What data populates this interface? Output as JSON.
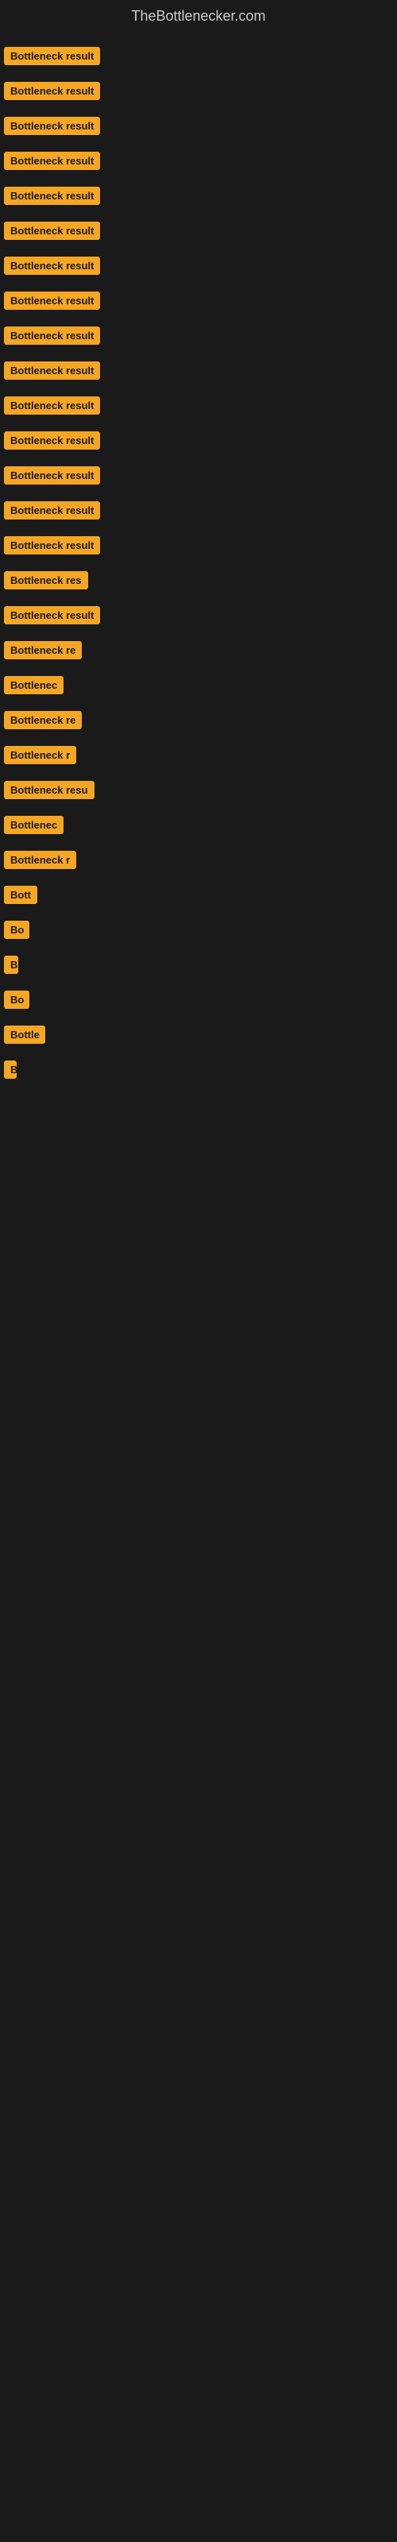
{
  "site": {
    "title": "TheBottlenecker.com"
  },
  "items": [
    {
      "label": "Bottleneck result",
      "width": 155
    },
    {
      "label": "Bottleneck result",
      "width": 155
    },
    {
      "label": "Bottleneck result",
      "width": 155
    },
    {
      "label": "Bottleneck result",
      "width": 155
    },
    {
      "label": "Bottleneck result",
      "width": 155
    },
    {
      "label": "Bottleneck result",
      "width": 155
    },
    {
      "label": "Bottleneck result",
      "width": 155
    },
    {
      "label": "Bottleneck result",
      "width": 155
    },
    {
      "label": "Bottleneck result",
      "width": 155
    },
    {
      "label": "Bottleneck result",
      "width": 155
    },
    {
      "label": "Bottleneck result",
      "width": 155
    },
    {
      "label": "Bottleneck result",
      "width": 155
    },
    {
      "label": "Bottleneck result",
      "width": 155
    },
    {
      "label": "Bottleneck result",
      "width": 155
    },
    {
      "label": "Bottleneck result",
      "width": 155
    },
    {
      "label": "Bottleneck res",
      "width": 120
    },
    {
      "label": "Bottleneck result",
      "width": 155
    },
    {
      "label": "Bottleneck re",
      "width": 110
    },
    {
      "label": "Bottlenec",
      "width": 85
    },
    {
      "label": "Bottleneck re",
      "width": 110
    },
    {
      "label": "Bottleneck r",
      "width": 100
    },
    {
      "label": "Bottleneck resu",
      "width": 125
    },
    {
      "label": "Bottlenec",
      "width": 80
    },
    {
      "label": "Bottleneck r",
      "width": 95
    },
    {
      "label": "Bott",
      "width": 45
    },
    {
      "label": "Bo",
      "width": 32
    },
    {
      "label": "B",
      "width": 18
    },
    {
      "label": "Bo",
      "width": 32
    },
    {
      "label": "Bottle",
      "width": 52
    },
    {
      "label": "B",
      "width": 14
    }
  ]
}
